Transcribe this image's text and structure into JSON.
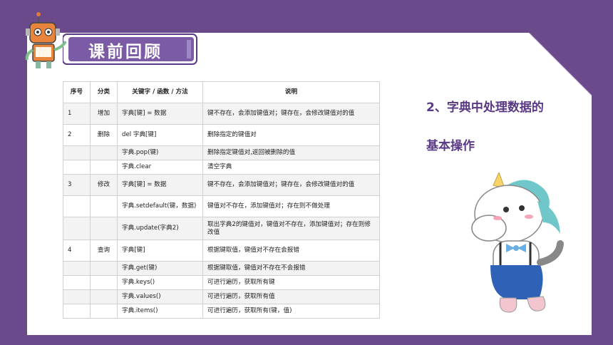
{
  "banner": {
    "title": "课前回顾"
  },
  "side": {
    "line1": "2、字典中处理数据的",
    "line2": "基本操作"
  },
  "table": {
    "headers": [
      "序号",
      "分类",
      "关键字 / 函数 / 方法",
      "说明"
    ],
    "rows": [
      {
        "no": "1",
        "cat": "增加",
        "key": "字典[键] = 数据",
        "desc": "键不存在，会添加键值对；键存在，会修改键值对的值"
      },
      {
        "no": "2",
        "cat": "删除",
        "key": "del 字典[键]",
        "desc": "删除指定的键值对"
      },
      {
        "no": "",
        "cat": "",
        "key": "字典.pop(键)",
        "desc": "删除指定键值对,返回被删除的值"
      },
      {
        "no": "",
        "cat": "",
        "key": "字典.clear",
        "desc": "清空字典"
      },
      {
        "no": "3",
        "cat": "修改",
        "key": "字典[键] = 数据",
        "desc": "键不存在，会添加键值对；键存在，会修改键值对的值"
      },
      {
        "no": "",
        "cat": "",
        "key": "字典.setdefault(键，数据)",
        "desc": "键值对不存在，添加键值对；存在则不做处理"
      },
      {
        "no": "",
        "cat": "",
        "key": "字典.update(字典2)",
        "desc": "取出字典2的键值对，键值对不存在，添加键值对；存在则修改值"
      },
      {
        "no": "4",
        "cat": "查询",
        "key": "字典[键]",
        "desc": "根据键取值，键值对不存在会报错"
      },
      {
        "no": "",
        "cat": "",
        "key": "字典.get(键)",
        "desc": "根据键取值，键值对不存在不会报错"
      },
      {
        "no": "",
        "cat": "",
        "key": "字典.keys()",
        "desc": "可进行遍历，获取所有键"
      },
      {
        "no": "",
        "cat": "",
        "key": "字典.values()",
        "desc": "可进行遍历，获取所有值"
      },
      {
        "no": "",
        "cat": "",
        "key": "字典.items()",
        "desc": "可进行遍历，获取所有(键，值)"
      }
    ]
  },
  "colors": {
    "background": "#6a4a8a",
    "accent": "#5b3a85",
    "banner": "#7b5aa6"
  },
  "icons": {
    "mascot_left": "robot-mascot",
    "mascot_right": "unicorn-mascot"
  }
}
